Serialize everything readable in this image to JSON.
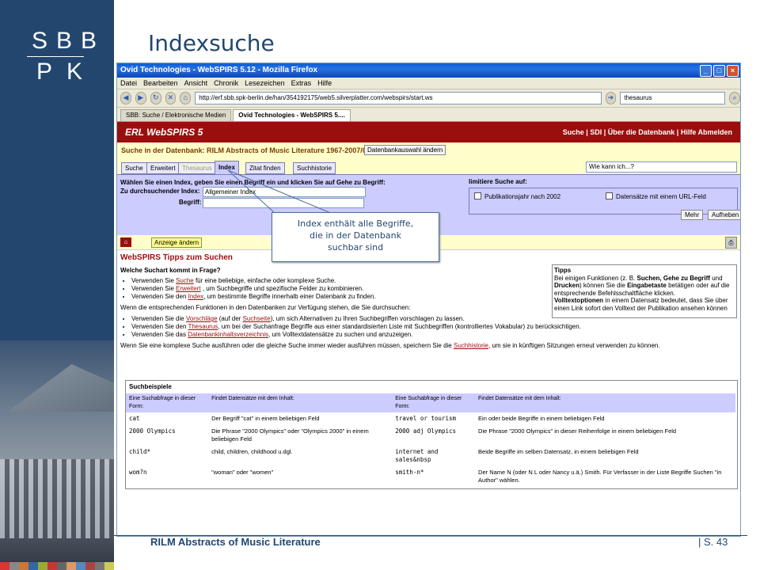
{
  "slide": {
    "logo_top": "SBB",
    "logo_bottom": "PK",
    "title": "Indexsuche",
    "footer_title": "RILM Abstracts of Music Literature",
    "footer_page": "| S. 43"
  },
  "browser": {
    "window_title": "Ovid Technologies - WebSPIRS 5.12 - Mozilla Firefox",
    "menu": [
      "Datei",
      "Bearbeiten",
      "Ansicht",
      "Chronik",
      "Lesezeichen",
      "Extras",
      "Hilfe"
    ],
    "url": "http://erf.sbb.spk-berlin.de/han/354192175/web5.silverplatter.com/webspirs/start.ws",
    "search_value": "thesaurus",
    "tabs": [
      {
        "label": "SBB: Suche / Elektronische Medien",
        "active": false
      },
      {
        "label": "Ovid Technologies - WebSPIRS 5....",
        "active": true
      }
    ]
  },
  "webspirs": {
    "brand": "ERL WebSPIRS 5",
    "header_links": "Suche | SDI | Über die Datenbank | Hilfe    Abmelden",
    "db_label": "Suche in der Datenbank: RILM Abstracts of Music Literature 1967-2007/09",
    "db_button": "Datenbankauswahl ändern",
    "search_tabs": [
      "Suche",
      "Erweitert",
      "Thesaurus",
      "Index",
      "Zitat finden",
      "Suchhistorie"
    ],
    "help_select": "Wie kann ich...?",
    "index_instructions": "Wählen Sie einen Index, geben Sie einen Begriff ein und klicken Sie auf Gehe zu Begriff:",
    "index_label": "Zu durchsuchender Index:",
    "index_value": "Allgemeiner Index",
    "term_label": "Begriff:",
    "limit_title": "limitiere Suche auf:",
    "limit_opt1": "Publikationsjahr nach 2002",
    "limit_opt2": "Datensätze mit einem URL-Feld",
    "btn_more": "Mehr",
    "btn_clear": "Aufheben",
    "btn_display": "Anzeige ändern"
  },
  "tips": {
    "title": "WebSPIRS Tipps zum Suchen",
    "q1": "Welche Suchart kommt in Frage?",
    "l1": [
      {
        "pre": "Verwenden Sie ",
        "link": "Suche",
        "post": " für eine beliebige, einfache oder komplexe Suche."
      },
      {
        "pre": "Verwenden Sie ",
        "link": "Erweitert",
        "post": " , um Suchbegriffe und spezifische Felder zu kombinieren."
      },
      {
        "pre": "Verwenden Sie den ",
        "link": "Index",
        "post": ", um bestimmte Begriffe innerhalb einer Datenbank zu finden."
      }
    ],
    "p2": "Wenn die entsprechenden Funktionen in den Datenbanken zur Verfügung stehen, die Sie durchsuchen:",
    "l2": [
      {
        "pre": "Verwenden Sie die ",
        "link": "Vorschläge",
        "mid": " (auf der ",
        "link2": "Suchseite",
        "post": "), um sich Alternativen zu Ihren Suchbegriffen vorschlagen zu lassen."
      },
      {
        "pre": "Verwenden Sie den ",
        "link": "Thesaurus",
        "mid": "",
        "link2": "",
        "post": ", um bei der Suchanfrage Begriffe aus einer standardisierten Liste mit Suchbegriffen (kontrolliertes Vokabular) zu berücksichtigen."
      },
      {
        "pre": "Verwenden Sie das ",
        "link": "Datenbankinhaltsverzeichnis",
        "mid": "",
        "link2": "",
        "post": ", um Volltextdatensätze zu suchen und anzuzeigen."
      }
    ],
    "p3_pre": "Wenn Sie eine komplexe Suche ausführen oder die gleiche Suche immer wieder ausführen müssen, speichern Sie die ",
    "p3_link": "Suchhistorie",
    "p3_post": ", um sie in künftigen Sitzungen erneut verwenden zu können.",
    "box_title": "Tipps",
    "box_text1": "Bei einigen Funktionen (z. B. ",
    "box_b1": "Suchen, Gehe zu Begriff",
    "box_text2": " und ",
    "box_b2": "Drucken",
    "box_text3": ") können Sie die ",
    "box_b3": "Eingabetaste",
    "box_text4": " betätigen oder auf die entsprechende Befehlsschaltfläche klicken.",
    "box_b4": "Volltextoptionen",
    "box_text5": " in einem Datensatz bedeutet, dass Sie über einen Link sofort den Volltext der Publikation ansehen können"
  },
  "examples": {
    "title": "Suchbeispiele",
    "headers": [
      "Eine Suchabfrage in dieser Form:",
      "Findet Datensätze mit dem Inhalt:",
      "Eine Suchabfrage in dieser Form:",
      "Findet Datensätze mit dem Inhalt:"
    ],
    "rows": [
      [
        "cat",
        "Der Begriff \"cat\" in einem beliebigen Feld",
        "travel or tourism",
        "Ein oder beide Begriffe in einem beliebigen Feld"
      ],
      [
        "2000 Olympics",
        "Die Phrase \"2000 Olympics\" oder \"Olympics 2000\" in einem beliebigen Feld",
        "2000 adj Olympics",
        "Die Phrase \"2000 Olympics\" in dieser Reihenfolge in einem beliebigen Feld"
      ],
      [
        "child*",
        "child, children, childhood u.dgl.",
        "internet and sales&nbsp",
        "Beide Begriffe im selben Datensatz, in einem beliebigen Feld"
      ],
      [
        "wom?n",
        "\"woman\" oder \"women\"",
        "smith-n*",
        "Der Name N (oder N L oder Nancy u.ä.) Smith. Für Verfasser in der Liste Begriffe Suchen \"in Author\" wählen."
      ]
    ]
  },
  "callout": {
    "line1": "Index enthält alle Begriffe,",
    "line2": "die in der Datenbank",
    "line3": "suchbar sind"
  },
  "colors": {
    "brand_blue": "#23466f",
    "webspirs_red": "#9b0e0e",
    "panel_lilac": "#ccccff",
    "panel_yellow": "#ffffcc"
  }
}
